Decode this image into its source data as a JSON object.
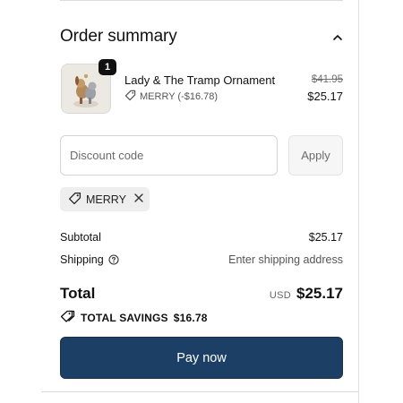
{
  "summary": {
    "title": "Order summary",
    "collapse_icon": "chevron-up-icon"
  },
  "line_item": {
    "name": "Lady & The Tramp Ornament",
    "quantity": "1",
    "discount_label": "MERRY (-$16.78)",
    "original_price": "$41.95",
    "price": "$25.17"
  },
  "discount": {
    "placeholder": "Discount code",
    "value": "",
    "apply_label": "Apply",
    "applied_code": "MERRY"
  },
  "totals": {
    "subtotal_label": "Subtotal",
    "subtotal_value": "$25.17",
    "shipping_label": "Shipping",
    "shipping_value": "Enter shipping address",
    "total_label": "Total",
    "currency": "USD",
    "total_value": "$25.17",
    "savings_label": "TOTAL SAVINGS",
    "savings_value": "$16.78"
  },
  "pay_button": {
    "label": "Pay now"
  },
  "colors": {
    "pay_button_bg": "#1c3f66",
    "chip_bg": "#eeeeee",
    "text": "#111111"
  }
}
